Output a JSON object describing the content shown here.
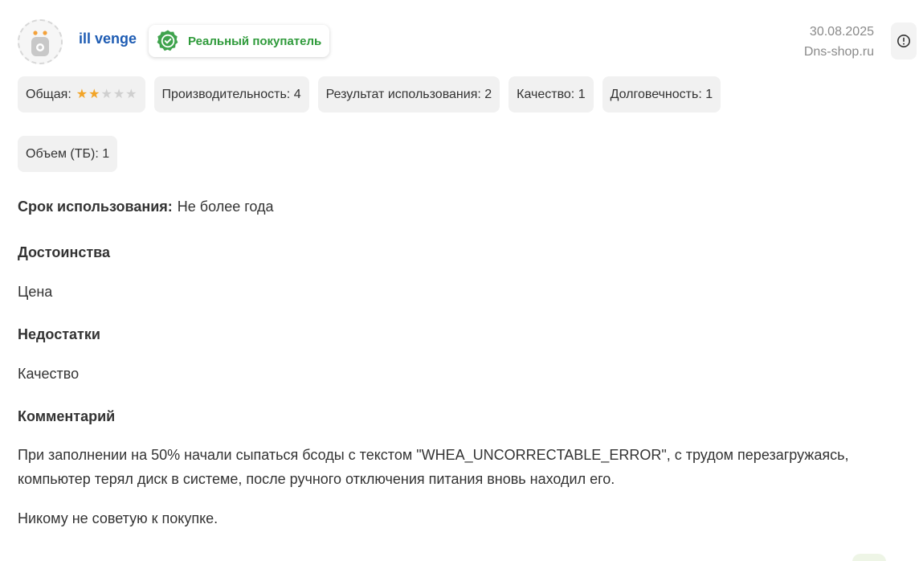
{
  "review": {
    "author": "ill venge",
    "badge_label": "Реальный покупатель",
    "date": "30.08.2025",
    "source": "Dns-shop.ru",
    "ratings": [
      {
        "label": "Общая:",
        "stars": 2,
        "max_stars": 5
      },
      {
        "label": "Производительность:",
        "value": "4"
      },
      {
        "label": "Результат использования:",
        "value": "2"
      },
      {
        "label": "Качество:",
        "value": "1"
      },
      {
        "label": "Долговечность:",
        "value": "1"
      },
      {
        "label": "Объем (ТБ):",
        "value": "1"
      }
    ],
    "usage": {
      "label": "Срок использования:",
      "value": "Не более года"
    },
    "pros": {
      "title": "Достоинства",
      "text": "Цена"
    },
    "cons": {
      "title": "Недостатки",
      "text": "Качество"
    },
    "comment": {
      "title": "Комментарий",
      "paragraph1_line1": "При заполнении на 50% начали сыпаться бсоды с текстом \"WHEA_UNCORRECTABLE_ERROR\", с трудом перезагружаясь,",
      "paragraph1_line2": "компьютер терял диск в системе, после ручного отключения питания вновь находил его.",
      "paragraph2": "Никому не советую к покупке."
    }
  },
  "icons": {
    "avatar": "robot-avatar-icon",
    "badge": "verified-check-icon",
    "report": "alert-circle-icon",
    "star": "star-icon"
  },
  "colors": {
    "author": "#1e5cb3",
    "badge_text": "#2e9a3a",
    "badge_icon": "#3fa34d",
    "star_on": "#f2a427",
    "star_off": "#cfcfcf",
    "chip_bg": "#f1f1f1",
    "meta_text": "#8a8a8a",
    "avatar_accent": "#f3a13a"
  }
}
